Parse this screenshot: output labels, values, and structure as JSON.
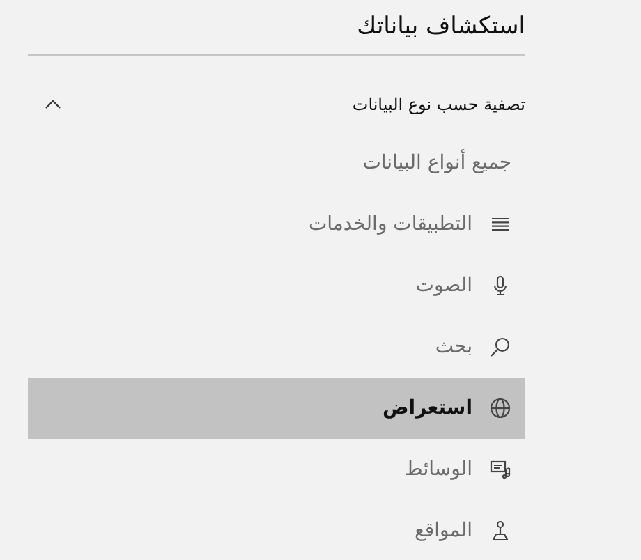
{
  "title": "استكشاف بياناتك",
  "filter": {
    "label": "تصفية حسب نوع البيانات",
    "expanded": true
  },
  "items": [
    {
      "label": "جميع أنواع البيانات",
      "kind": "all",
      "selected": false
    },
    {
      "label": "التطبيقات والخدمات",
      "kind": "apps",
      "selected": false
    },
    {
      "label": "الصوت",
      "kind": "voice",
      "selected": false
    },
    {
      "label": "بحث",
      "kind": "search",
      "selected": false
    },
    {
      "label": "استعراض",
      "kind": "browse",
      "selected": true
    },
    {
      "label": "الوسائط",
      "kind": "media",
      "selected": false
    },
    {
      "label": "المواقع",
      "kind": "places",
      "selected": false
    }
  ]
}
